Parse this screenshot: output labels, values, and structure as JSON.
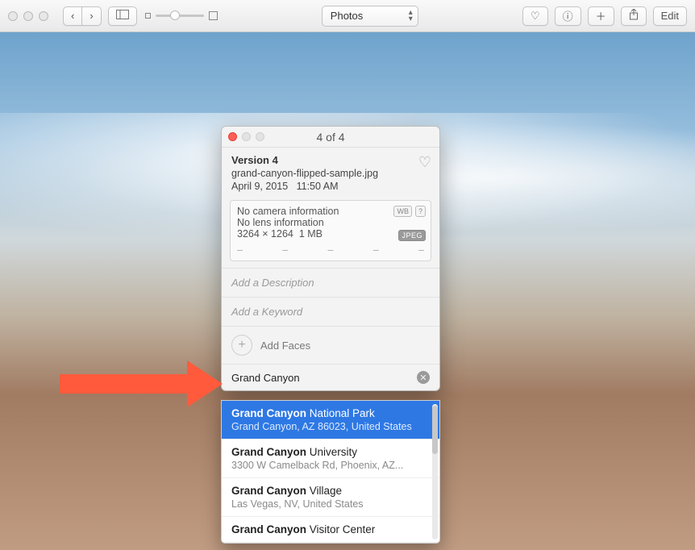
{
  "toolbar": {
    "view_label": "Photos",
    "edit_label": "Edit"
  },
  "info": {
    "counter": "4 of 4",
    "version": "Version 4",
    "filename": "grand-canyon-flipped-sample.jpg",
    "date": "April 9, 2015",
    "time": "11:50 AM",
    "camera": "No camera information",
    "lens": "No lens information",
    "dims": "3264 × 1264",
    "filesize": "1 MB",
    "format_badge": "JPEG",
    "wb_badge": "WB",
    "help_badge": "?",
    "desc_placeholder": "Add a Description",
    "keyword_placeholder": "Add a Keyword",
    "faces_label": "Add Faces",
    "location_value": "Grand Canyon"
  },
  "suggestions": [
    {
      "bold": "Grand Canyon",
      "rest": " National Park",
      "sub": "Grand Canyon, AZ 86023, United States",
      "selected": true
    },
    {
      "bold": "Grand Canyon",
      "rest": " University",
      "sub": "3300 W Camelback Rd, Phoenix, AZ...",
      "selected": false
    },
    {
      "bold": "Grand Canyon",
      "rest": " Village",
      "sub": "Las Vegas, NV, United States",
      "selected": false
    },
    {
      "bold": "Grand Canyon",
      "rest": " Visitor Center",
      "sub": "",
      "selected": false
    }
  ]
}
